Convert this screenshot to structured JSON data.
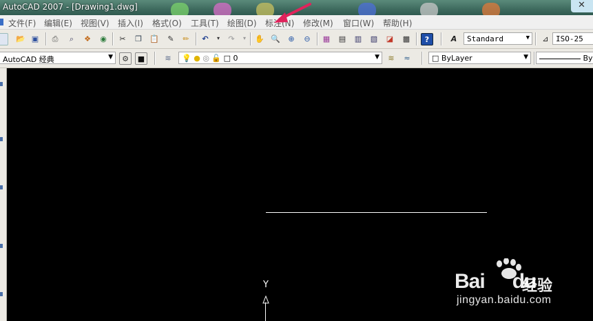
{
  "window": {
    "title": "AutoCAD 2007 - [Drawing1.dwg]"
  },
  "menu": {
    "items": [
      "文件(F)",
      "编辑(E)",
      "视图(V)",
      "插入(I)",
      "格式(O)",
      "工具(T)",
      "绘图(D)",
      "标注(N)",
      "修改(M)",
      "窗口(W)",
      "帮助(H)"
    ]
  },
  "toolbar1": {
    "text_style": "Standard",
    "dim_style": "ISO-25"
  },
  "toolbar2": {
    "workspace": "AutoCAD 经典",
    "layer": "0",
    "color": "ByLayer",
    "linetype": "ByL"
  },
  "canvas": {
    "ucs_y_label": "Y"
  },
  "watermark": {
    "brand": "Bai",
    "brand_du": "du",
    "brand_cn": "经验",
    "url": "jingyan.baidu.com"
  },
  "colors": {
    "canvas": "#000000",
    "toolbar": "#eceae4",
    "accent_arrow": "#e0235b"
  }
}
